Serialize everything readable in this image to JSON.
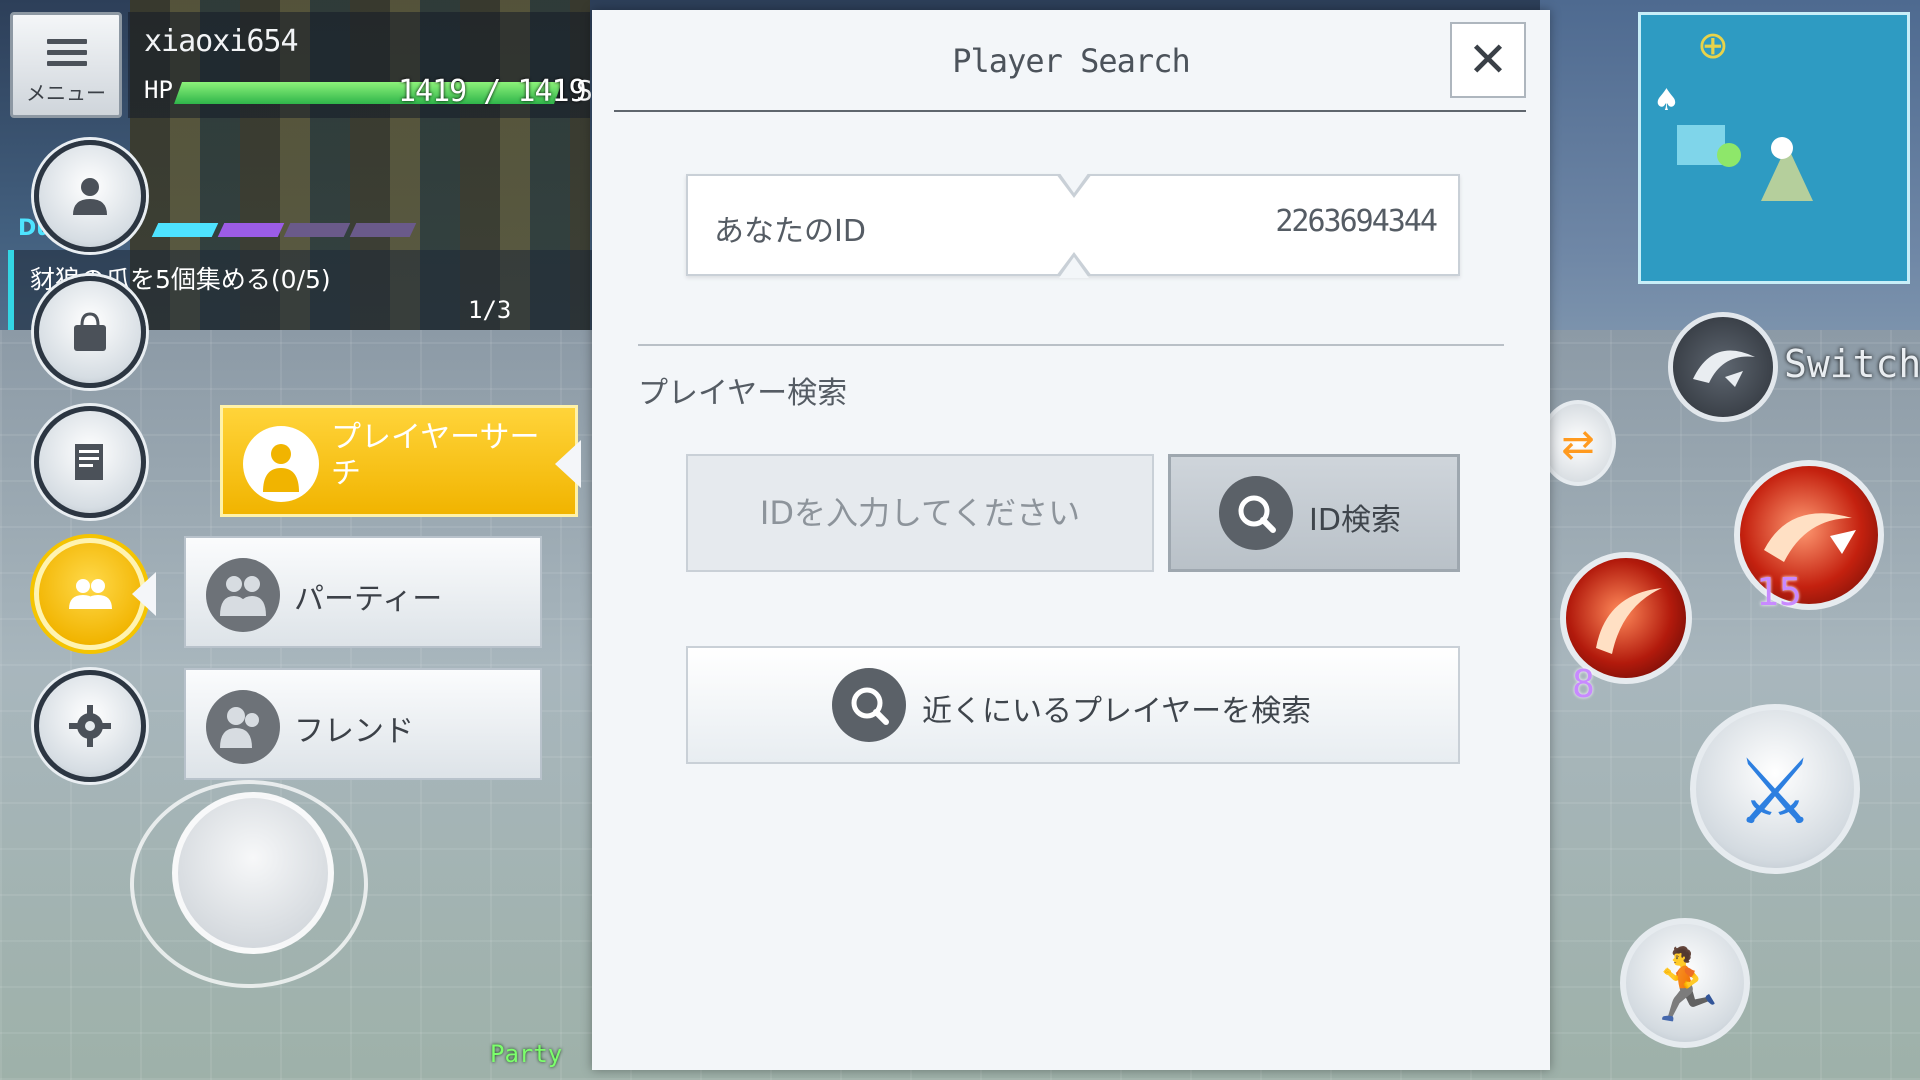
{
  "hud": {
    "menu_label": "メニュー",
    "player_name": "xiaoxi654",
    "hp_label": "HP",
    "hp_current": 1419,
    "hp_max": 1419,
    "hp_text": "1419 / 1419",
    "hp_extra": "S",
    "hp_color": "#2fb54a",
    "quest_tag": "Du",
    "quest_text": "豺狼の爪を5個集める(0/5)",
    "quest_count": "1/3",
    "quest_bar_colors": [
      "#4ee3ff",
      "#9b5ce6",
      "#6a5a8a",
      "#6a5a8a"
    ],
    "party_tag": "Party"
  },
  "side_menu": {
    "buttons": [
      {
        "name": "profile",
        "icon": "person-icon"
      },
      {
        "name": "bag",
        "icon": "bag-icon"
      },
      {
        "name": "quests",
        "icon": "notes-icon"
      },
      {
        "name": "social",
        "icon": "group-icon",
        "active": true
      },
      {
        "name": "settings",
        "icon": "gear-icon"
      }
    ],
    "submenu": {
      "player_search": "プレイヤーサーチ",
      "party": "パーティー",
      "friend": "フレンド"
    }
  },
  "combat": {
    "switch_label": "Switch",
    "skill_1_count": "15",
    "skill_2_count": "8"
  },
  "modal": {
    "title": "Player Search",
    "your_id_label": "あなたのID",
    "your_id_value": "2263694344",
    "section_title": "プレイヤー検索",
    "id_input_placeholder": "IDを入力してください",
    "id_input_value": "",
    "id_search_label": "ID検索",
    "nearby_search_label": "近くにいるプレイヤーを検索"
  },
  "colors": {
    "accent_yellow": "#f1b400",
    "minimap": "#2e9bc2",
    "skill_red": "#c4210f",
    "skill_count": "#c88aff"
  }
}
